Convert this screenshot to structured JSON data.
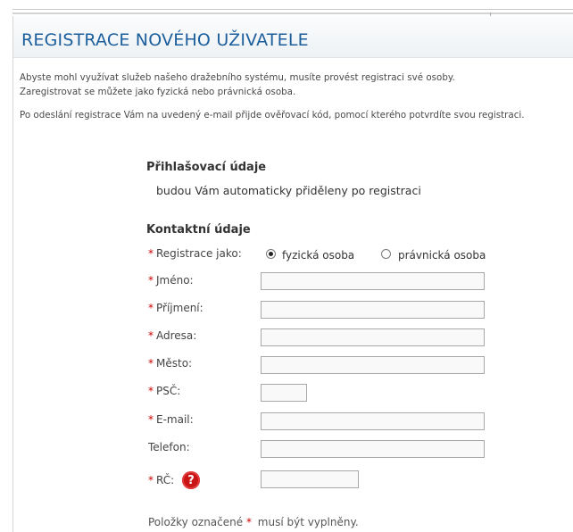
{
  "page": {
    "title": "REGISTRACE NOVÉHO UŽIVATELE",
    "intro_line_1": "Abyste mohl využívat služeb našeho dražebního systému, musíte provést registraci své osoby.",
    "intro_line_2": "Zaregistrovat se můžete jako fyzická nebo právnická osoba.",
    "intro_line_3": "Po odeslání registrace Vám na uvedený e-mail přijde ověřovací kód, pomocí kterého potvrdíte svou registraci."
  },
  "login_section": {
    "heading": "Přihlašovací údaje",
    "note": "budou Vám automaticky přiděleny po registraci"
  },
  "contact_section": {
    "heading": "Kontaktní údaje",
    "required_mark": "*",
    "registration_type": {
      "label": "Registrace jako:",
      "options": [
        "fyzická osoba",
        "právnická osoba"
      ],
      "selected": "fyzická osoba"
    },
    "fields": {
      "first_name": {
        "label": "Jméno:",
        "value": ""
      },
      "last_name": {
        "label": "Příjmení:",
        "value": ""
      },
      "address": {
        "label": "Adresa:",
        "value": ""
      },
      "city": {
        "label": "Město:",
        "value": ""
      },
      "zip": {
        "label": "PSČ:",
        "value": ""
      },
      "email": {
        "label": "E-mail:",
        "value": ""
      },
      "phone": {
        "label": "Telefon:",
        "value": ""
      },
      "birth_number": {
        "label": "RČ:",
        "value": "",
        "help_icon": "question-icon"
      }
    },
    "footnote_before": "Položky označené",
    "footnote_after": "musí být vyplněny."
  },
  "colors": {
    "title": "#1c5f9c",
    "required": "#cc0000",
    "help_icon": "#c81414"
  }
}
